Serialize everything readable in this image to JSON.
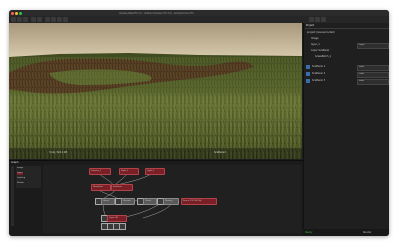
{
  "window": {
    "title": "Clarisse Beta/iFX 3.0 - Untitled (Clarisse iFX 3.0) - IsotropixCloud iFX"
  },
  "colors": {
    "bg": "#1d1d1d",
    "node_red": "#7b1f26",
    "node_grey": "#5a5a5a",
    "status_ok": "#3fae3f",
    "accent": "#3b6ea8"
  },
  "viewport": {
    "status_left": "3 obj, 524.1 kB",
    "status_right": "Scattered"
  },
  "right_panel": {
    "header": "Project",
    "items": [
      {
        "label": "project://scene/context"
      },
      {
        "label": "Image"
      },
      {
        "label": "layer_1"
      },
      {
        "label": "Layer Scatterer"
      },
      {
        "label": "GrassPatch_1"
      },
      {
        "label": "Scatterer 1"
      },
      {
        "label": "Scatterer 2"
      },
      {
        "label": "Scatterer 3"
      }
    ],
    "values": [
      "Layer",
      "node",
      "node",
      "node"
    ]
  },
  "bottom": {
    "tab": "Graph",
    "list": [
      "Image",
      "Layer",
      "Lighting",
      "Shader"
    ],
    "nodes": [
      {
        "label": "Camera_1"
      },
      {
        "label": "Light_1"
      },
      {
        "label": "Light_2"
      },
      {
        "label": "GrassSurf"
      },
      {
        "label": "Scatterer"
      },
      {
        "label": "Grass"
      },
      {
        "label": "Ground"
      },
      {
        "label": "Cloud"
      },
      {
        "label": "Density"
      },
      {
        "label": "Layer 3D"
      },
      {
        "label": "Scene 2.9 (58 Obj)"
      }
    ]
  },
  "statusbar": {
    "left": "Ready",
    "right": "Render"
  }
}
